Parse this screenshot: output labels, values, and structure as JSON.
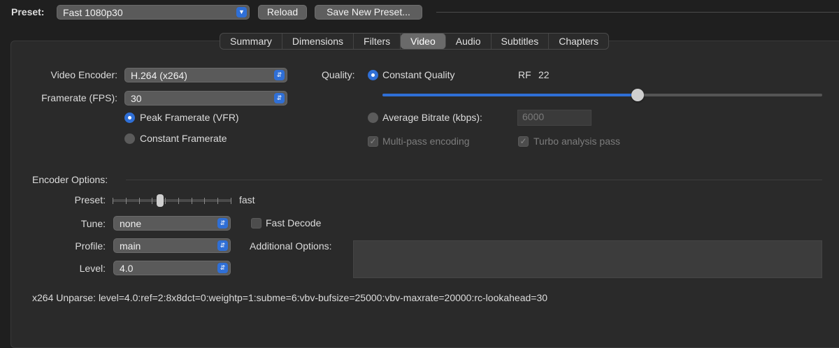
{
  "toolbar": {
    "preset_label": "Preset:",
    "preset_value": "Fast 1080p30",
    "reload_label": "Reload",
    "save_new_preset_label": "Save New Preset..."
  },
  "tabs": [
    {
      "label": "Summary"
    },
    {
      "label": "Dimensions"
    },
    {
      "label": "Filters"
    },
    {
      "label": "Video",
      "active": true
    },
    {
      "label": "Audio"
    },
    {
      "label": "Subtitles"
    },
    {
      "label": "Chapters"
    }
  ],
  "video": {
    "encoder_label": "Video Encoder:",
    "encoder_value": "H.264 (x264)",
    "framerate_label": "Framerate (FPS):",
    "framerate_value": "30",
    "peak_framerate_label": "Peak Framerate (VFR)",
    "constant_framerate_label": "Constant Framerate",
    "peak_framerate_selected": true
  },
  "quality": {
    "label": "Quality:",
    "constant_quality_label": "Constant Quality",
    "constant_quality_selected": true,
    "rf_label": "RF",
    "rf_value": "22",
    "slider_fraction": 0.58,
    "average_bitrate_label": "Average Bitrate (kbps):",
    "average_bitrate_value": "6000",
    "multipass_label": "Multi-pass encoding",
    "turbo_label": "Turbo analysis pass"
  },
  "encoder_options": {
    "section_label": "Encoder Options:",
    "preset_label": "Preset:",
    "preset_value": "fast",
    "preset_slider_fraction": 0.4,
    "tune_label": "Tune:",
    "tune_value": "none",
    "fast_decode_label": "Fast Decode",
    "profile_label": "Profile:",
    "profile_value": "main",
    "additional_options_label": "Additional Options:",
    "level_label": "Level:",
    "level_value": "4.0"
  },
  "unparse": "x264 Unparse: level=4.0:ref=2:8x8dct=0:weightp=1:subme=6:vbv-bufsize=25000:vbv-maxrate=20000:rc-lookahead=30",
  "colors": {
    "accent": "#2f6fd6",
    "background": "#1f1f1f",
    "panel": "#2a2a2a"
  }
}
